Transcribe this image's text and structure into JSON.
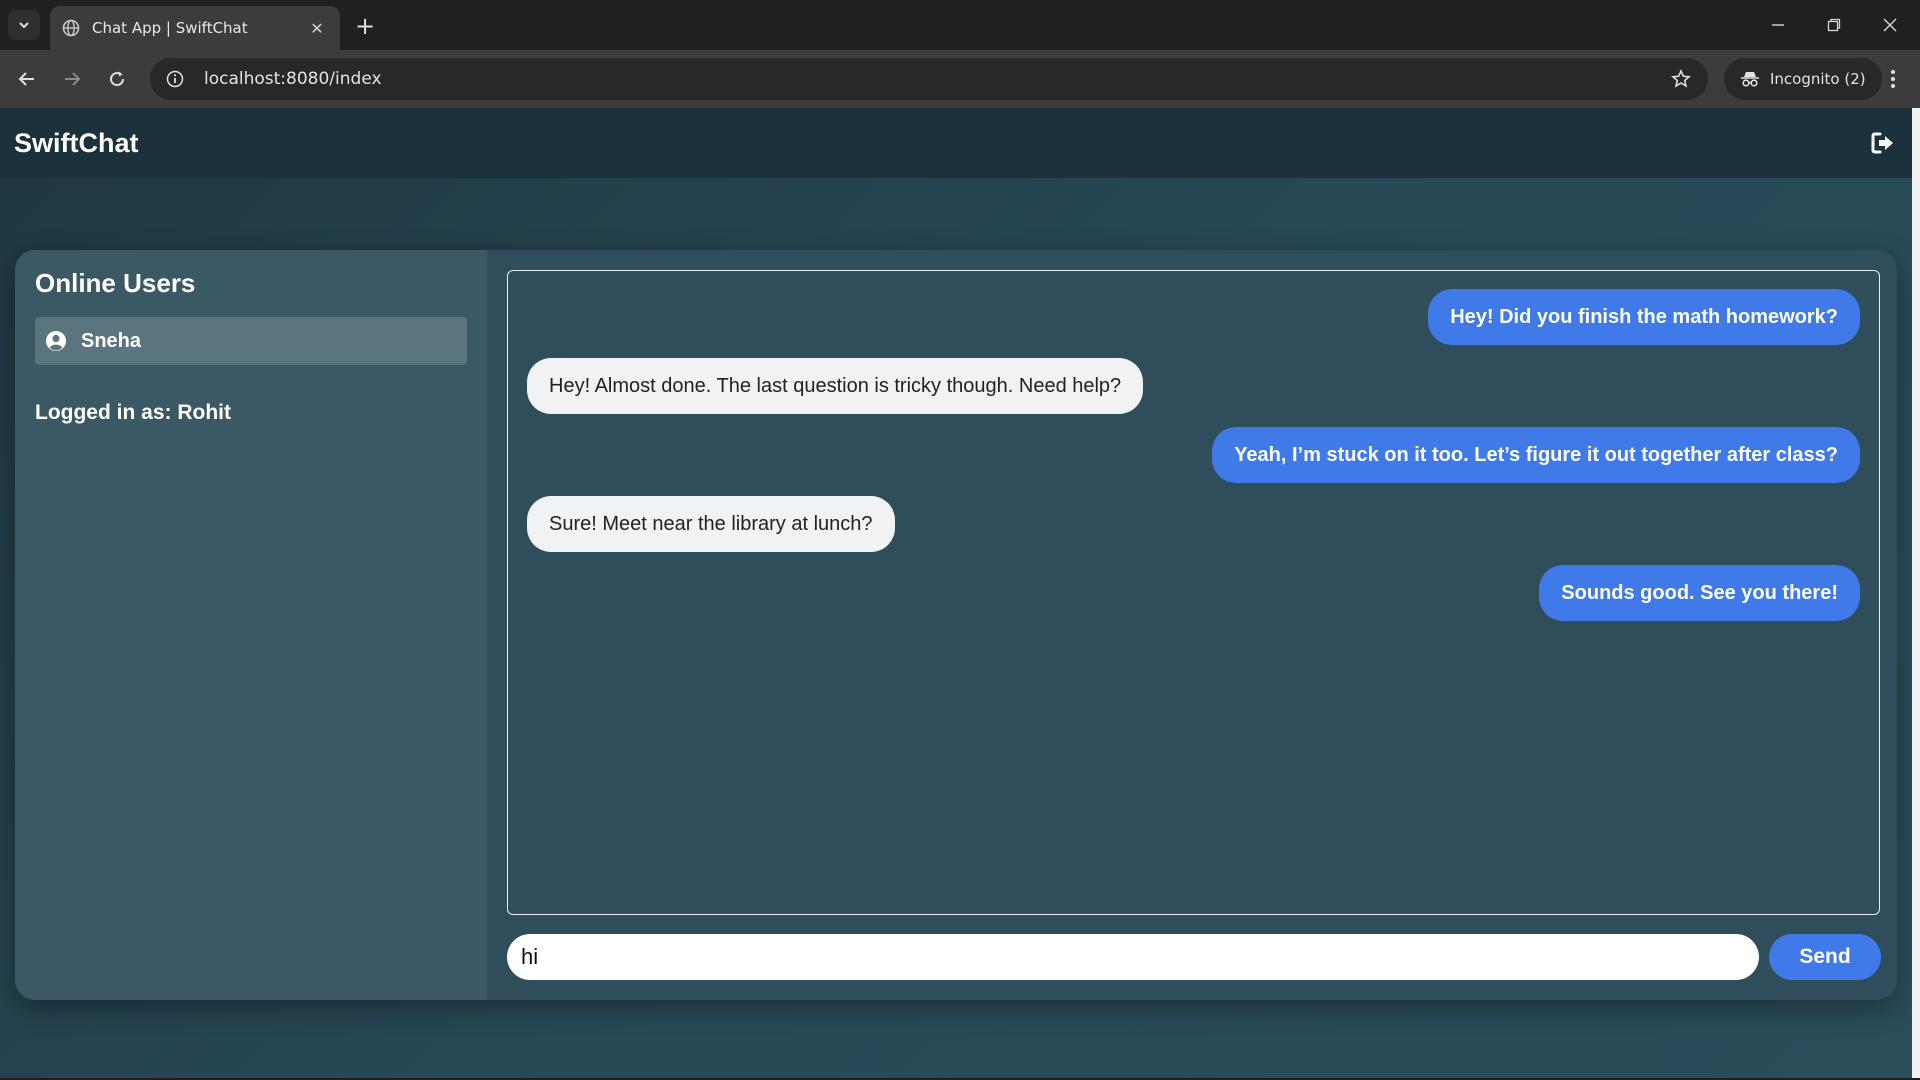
{
  "browser": {
    "tab_title": "Chat App | SwiftChat",
    "url": "localhost:8080/index",
    "incognito_label": "Incognito (2)"
  },
  "app": {
    "brand": "SwiftChat"
  },
  "sidebar": {
    "title": "Online Users",
    "users": [
      {
        "name": "Sneha"
      }
    ],
    "logged_in": "Logged in as: Rohit"
  },
  "messages": [
    {
      "direction": "sent",
      "text": "Hey! Did you finish the math homework?"
    },
    {
      "direction": "received",
      "text": "Hey! Almost done. The last question is tricky though. Need help?"
    },
    {
      "direction": "sent",
      "text": "Yeah, I’m stuck on it too. Let’s figure it out together after class?"
    },
    {
      "direction": "received",
      "text": "Sure! Meet near the library at lunch?"
    },
    {
      "direction": "sent",
      "text": "Sounds good. See you there!"
    }
  ],
  "composer": {
    "value": "hi",
    "send_label": "Send"
  },
  "colors": {
    "sent_bubble": "#3f7ae8",
    "received_bubble": "#f1f2f4",
    "header": "#1b313b",
    "sidebar": "#3b5865"
  }
}
